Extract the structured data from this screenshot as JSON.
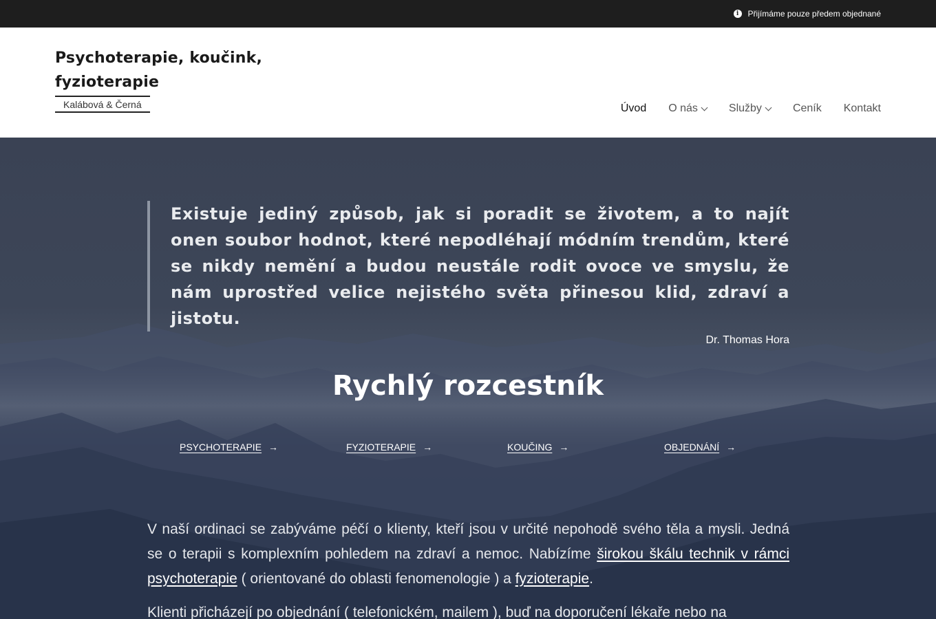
{
  "topbar": {
    "notice": "Přijímáme pouze předem objednané",
    "icon": "info-icon"
  },
  "brand": {
    "title_line1": "Psychoterapie, koučink,",
    "title_line2": "fyzioterapie",
    "subtitle": "Kalábová & Černá"
  },
  "nav": {
    "items": [
      {
        "label": "Úvod",
        "active": true,
        "dropdown": false
      },
      {
        "label": "O nás",
        "active": false,
        "dropdown": true
      },
      {
        "label": "Služby",
        "active": false,
        "dropdown": true
      },
      {
        "label": "Ceník",
        "active": false,
        "dropdown": false
      },
      {
        "label": "Kontakt",
        "active": false,
        "dropdown": false
      }
    ]
  },
  "quote": {
    "text": "Existuje jediný způsob, jak si poradit se životem, a to najít onen soubor hodnot, které nepodléhají módním trendům, které se nikdy nemění a budou neustále rodit ovoce ve smyslu, že nám uprostřed velice nejistého světa přinesou klid, zdraví a jistotu.",
    "author": "Dr. Thomas Hora"
  },
  "hub": {
    "title": "Rychlý rozcestník",
    "links": [
      "PSYCHOTERAPIE",
      "FYZIOTERAPIE",
      "KOUČING",
      "OBJEDNÁNÍ"
    ],
    "arrow": "→"
  },
  "intro": {
    "p1_a": "V naší ordinaci se zabýváme péčí o klienty, kteří jsou v určité nepohodě svého těla a mysli. Jedná se o terapii s komplexním pohledem na zdraví a nemoc. Nabízíme ",
    "p1_link1": "širokou škálu technik v rámci psychoterapie",
    "p1_b": " ( orientované do oblasti fenomenologie )  a ",
    "p1_link2": "fyzioterapie",
    "p1_c": ".",
    "p2_a": "Klienti přicházejí po objednání ( telefonickém, mailem ), buď na doporučení lékaře nebo na"
  },
  "colors": {
    "topbar": "#1e1e1e",
    "hero": "#3d4658",
    "accent_border": "#8e96a3"
  }
}
